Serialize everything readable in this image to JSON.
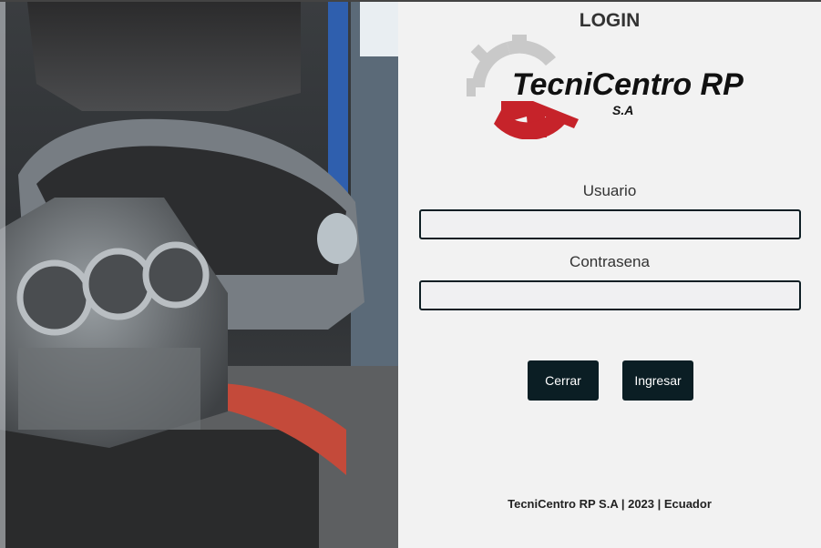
{
  "login": {
    "title": "LOGIN",
    "brand": {
      "name": "TecniCentro RP",
      "suffix": "S.A"
    },
    "username_label": "Usuario",
    "username_value": "",
    "password_label": "Contrasena",
    "password_value": "",
    "close_label": "Cerrar",
    "submit_label": "Ingresar",
    "footer": "TecniCentro RP S.A | 2023 | Ecuador"
  },
  "colors": {
    "button_bg": "#0b1e24",
    "logo_red": "#c6232a",
    "logo_gray": "#c9c9c9",
    "panel_bg": "#f2f2f2"
  },
  "icons": {
    "logo": "gear-logo-icon"
  }
}
